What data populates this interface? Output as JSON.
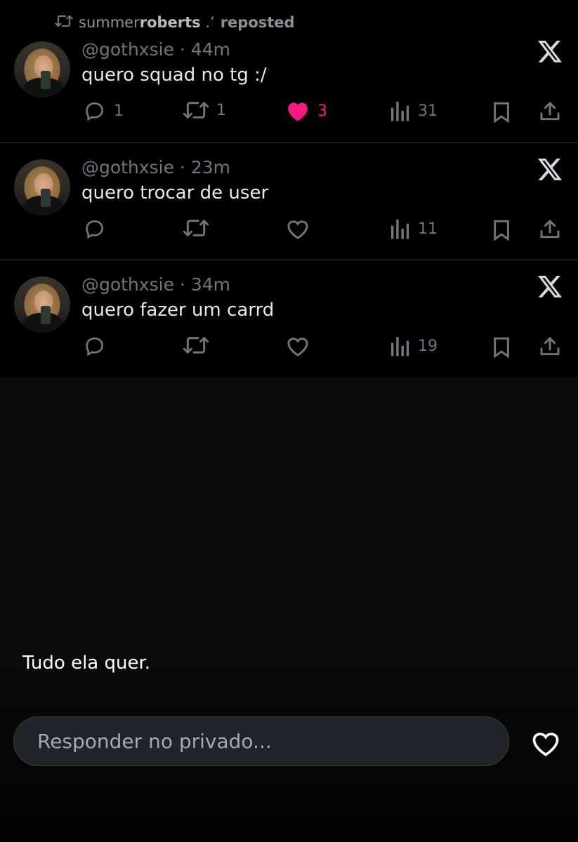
{
  "repost": {
    "user_prefix": "summer",
    "user_bold": "roberts",
    "user_suffix": " .’",
    "action": "reposted"
  },
  "tweets": [
    {
      "handle": "@gothxsie",
      "time": "44m",
      "text": "quero squad no tg :/",
      "replies": "1",
      "reposts": "1",
      "likes": "3",
      "liked": true,
      "views": "31"
    },
    {
      "handle": "@gothxsie",
      "time": "23m",
      "text": "quero trocar de user",
      "replies": "",
      "reposts": "",
      "likes": "",
      "liked": false,
      "views": "11"
    },
    {
      "handle": "@gothxsie",
      "time": "34m",
      "text": "quero fazer um carrd",
      "replies": "",
      "reposts": "",
      "likes": "",
      "liked": false,
      "views": "19"
    }
  ],
  "story": {
    "caption": "Tudo ela quer."
  },
  "reply": {
    "placeholder": "Responder no privado..."
  },
  "colors": {
    "like_accent": "#f91880",
    "muted": "#71767b",
    "background": "#000000"
  },
  "icons": [
    "repost-icon",
    "x-logo-icon",
    "reply-icon",
    "like-icon",
    "views-icon",
    "bookmark-icon",
    "share-icon",
    "heart-icon"
  ]
}
